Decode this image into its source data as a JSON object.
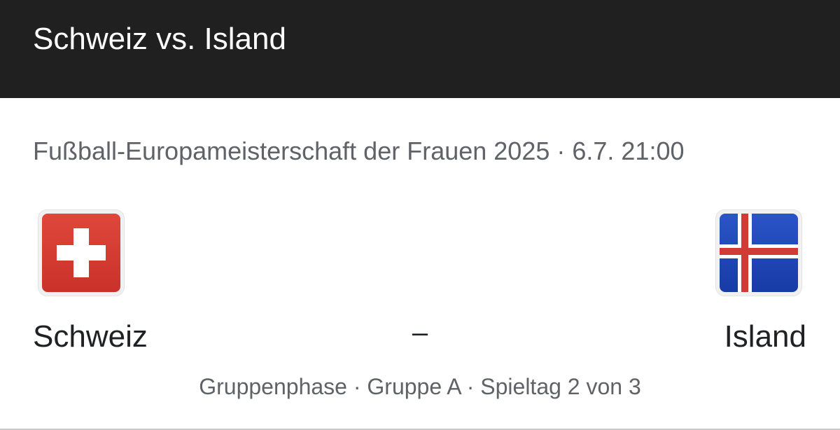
{
  "header": {
    "title": "Schweiz vs. Island"
  },
  "match": {
    "competition_line": "Fußball-Europameisterschaft der Frauen 2025 · 6.7. 21:00",
    "home_team": {
      "name": "Schweiz",
      "flag_icon": "switzerland-flag-icon"
    },
    "away_team": {
      "name": "Island",
      "flag_icon": "iceland-flag-icon"
    },
    "score": "–",
    "round_info": "Gruppenphase · Gruppe A · Spieltag 2 von 3"
  },
  "colors": {
    "header_bg": "#202020",
    "swiss_red": "#d93a2f",
    "iceland_blue": "#1d46b8",
    "iceland_red": "#d23b34"
  }
}
